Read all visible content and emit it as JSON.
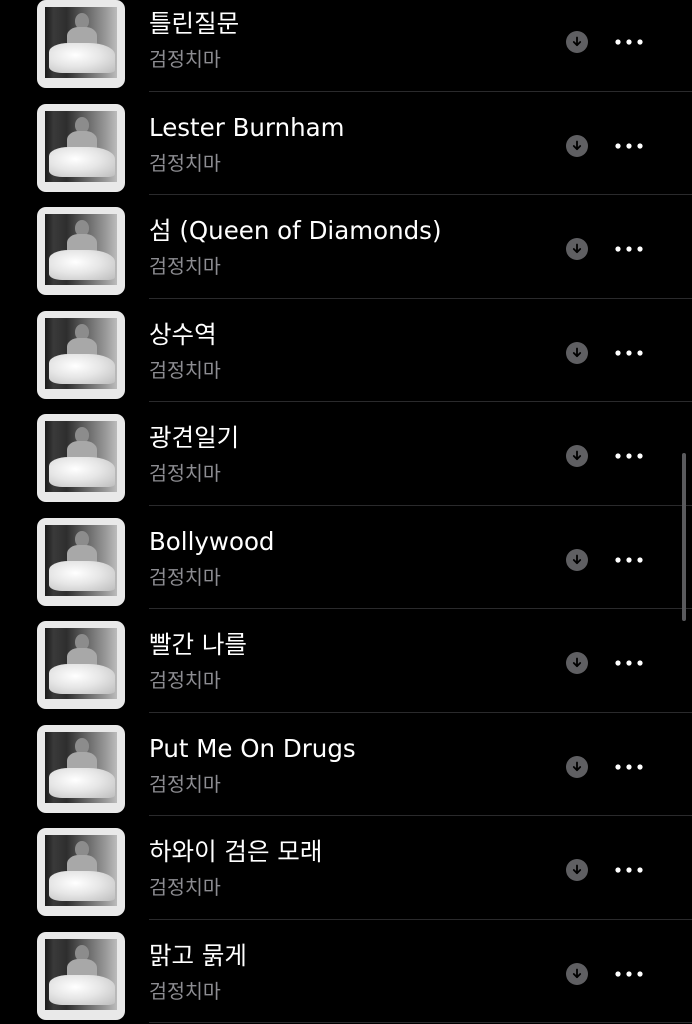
{
  "tracks": [
    {
      "title": "틀린질문",
      "artist": "검정치마"
    },
    {
      "title": "Lester Burnham",
      "artist": "검정치마"
    },
    {
      "title": "섬 (Queen of Diamonds)",
      "artist": "검정치마"
    },
    {
      "title": "상수역",
      "artist": "검정치마"
    },
    {
      "title": "광견일기",
      "artist": "검정치마"
    },
    {
      "title": "Bollywood",
      "artist": "검정치마"
    },
    {
      "title": "빨간 나를",
      "artist": "검정치마"
    },
    {
      "title": "Put Me On Drugs",
      "artist": "검정치마"
    },
    {
      "title": "하와이 검은 모래",
      "artist": "검정치마"
    },
    {
      "title": "맑고 묽게",
      "artist": "검정치마"
    }
  ],
  "icons": {
    "download": "download-arrow-icon",
    "more": "ellipsis-icon"
  },
  "colors": {
    "background": "#000000",
    "title": "#ffffff",
    "artist": "#8d8d92",
    "icon": "#5f5f62"
  }
}
